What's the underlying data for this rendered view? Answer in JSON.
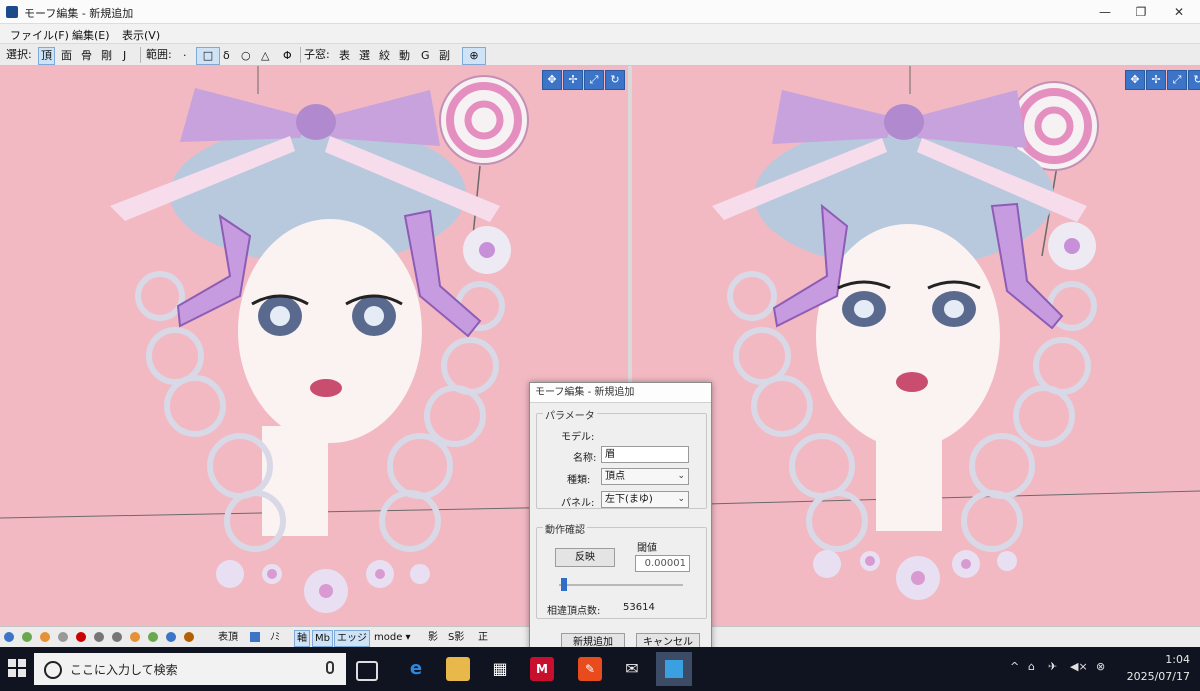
{
  "window": {
    "title": "モーフ編集 - 新規追加",
    "controls": {
      "minimize": "—",
      "restore": "❐",
      "close": "✕"
    }
  },
  "menu": [
    "ファイル(F)",
    "編集(E)",
    "表示(V)"
  ],
  "toolbar": {
    "select_label": "選択:",
    "select_items": [
      "頂",
      "面",
      "骨",
      "剛",
      "J"
    ],
    "range_label": "範囲:",
    "range_items": [
      "·",
      "□",
      "δ",
      "○",
      "△",
      "Φ"
    ],
    "sub_label": "子窓:",
    "sub_items": [
      "表",
      "選",
      "絞",
      "動",
      "G",
      "副"
    ],
    "active_select": "頂",
    "active_range": "□"
  },
  "viewports": {
    "nav_icons": [
      "✥",
      "✢",
      "⤢",
      "↻"
    ]
  },
  "dialog": {
    "title": "モーフ編集 - 新規追加",
    "params_group": "パラメータ",
    "model_label": "モデル:",
    "name_label": "名称:",
    "name_value": "眉",
    "type_label": "種類:",
    "type_value": "頂点",
    "panel_label": "パネル:",
    "panel_value": "左下(まゆ)",
    "confirm_group": "動作確認",
    "apply_button": "反映",
    "threshold_label": "閾値",
    "threshold_value": "0.00001",
    "slider_value": 0.02,
    "diff_label": "相違頂点数:",
    "diff_value": "53614",
    "new_add_button": "新規追加",
    "cancel_button": "キャンセル"
  },
  "statusbar": {
    "items": [
      "表頂",
      "ﾉﾐ",
      "軸",
      "Mb",
      "エッジ",
      "mode ▾",
      "影",
      "S影",
      "正"
    ],
    "active": [
      "軸",
      "Mb",
      "エッジ"
    ]
  },
  "taskbar": {
    "search_placeholder": "ここに入力して検索",
    "time": "1:04",
    "date": "2025/07/17",
    "tray": [
      "^",
      "⌂",
      "✈",
      "◀×",
      "⊗"
    ]
  },
  "colors": {
    "viewport_bg": "#f2b9c3",
    "accent": "#3c74c8",
    "taskbar": "#0f1420"
  }
}
